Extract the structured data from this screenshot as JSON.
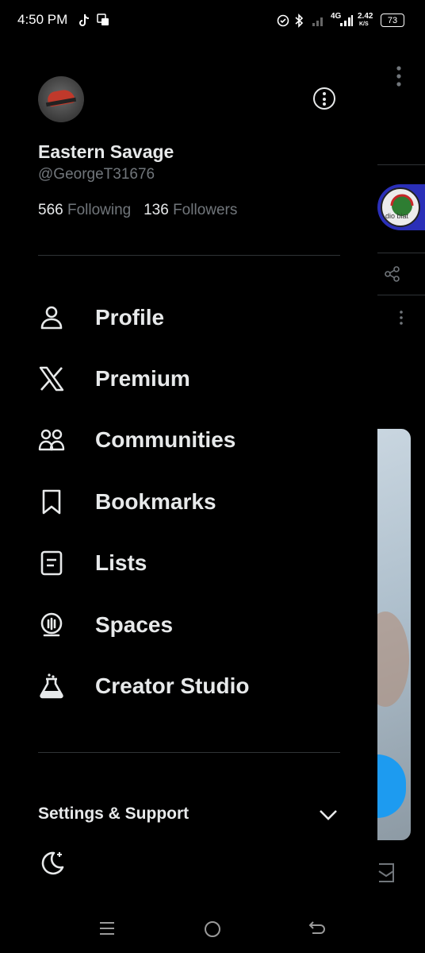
{
  "status_bar": {
    "time": "4:50 PM",
    "net_speed": "2.42",
    "net_unit": "K/S",
    "network": "4G",
    "battery": "73"
  },
  "profile": {
    "display_name": "Eastern Savage",
    "handle": "@GeorgeT31676",
    "following_count": "566",
    "following_label": "Following",
    "followers_count": "136",
    "followers_label": "Followers"
  },
  "menu": {
    "items": [
      {
        "label": "Profile",
        "icon": "person-icon"
      },
      {
        "label": "Premium",
        "icon": "x-logo-icon"
      },
      {
        "label": "Communities",
        "icon": "communities-icon"
      },
      {
        "label": "Bookmarks",
        "icon": "bookmark-icon"
      },
      {
        "label": "Lists",
        "icon": "list-icon"
      },
      {
        "label": "Spaces",
        "icon": "spaces-icon"
      },
      {
        "label": "Creator Studio",
        "icon": "flask-icon"
      }
    ]
  },
  "settings_section": {
    "label": "Settings & Support"
  },
  "background_feed": {
    "avatar_text": "dio biat"
  },
  "colors": {
    "background": "#000000",
    "text": "#e7e9ea",
    "muted": "#71767b",
    "divider": "#2f3336",
    "accent": "#1d9bf0"
  }
}
